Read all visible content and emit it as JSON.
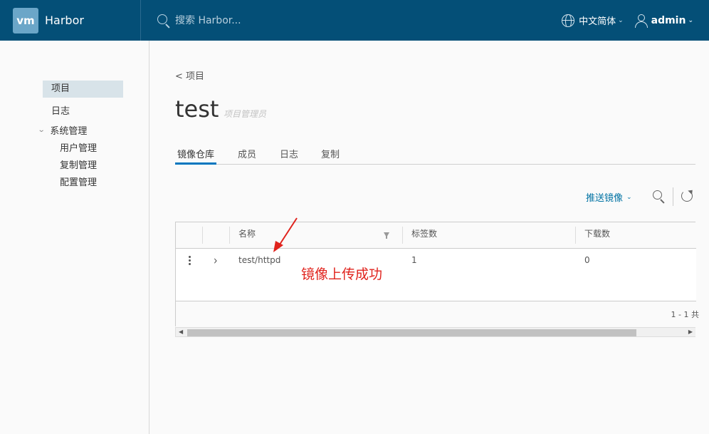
{
  "header": {
    "logo_text": "vm",
    "app_name": "Harbor",
    "search_placeholder": "搜索 Harbor...",
    "language": "中文简体",
    "user": "admin"
  },
  "sidebar": {
    "items": [
      {
        "label": "项目",
        "active": true
      },
      {
        "label": "日志"
      },
      {
        "label": "系统管理",
        "expanded": true
      }
    ],
    "admin_sub": [
      "用户管理",
      "复制管理",
      "配置管理"
    ]
  },
  "main": {
    "back_label": "< 项目",
    "title": "test",
    "role": "项目管理员",
    "tabs": [
      {
        "label": "镜像仓库",
        "active": true
      },
      {
        "label": "成员"
      },
      {
        "label": "日志"
      },
      {
        "label": "复制"
      }
    ],
    "push_image_label": "推送镜像",
    "table": {
      "columns": [
        "名称",
        "标签数",
        "下载数"
      ],
      "rows": [
        {
          "name": "test/httpd",
          "tags": "1",
          "pulls": "0"
        }
      ],
      "pagination": "1 - 1 共"
    },
    "annotation": "镜像上传成功"
  },
  "colors": {
    "header_bg": "#044f77",
    "accent": "#0076bf",
    "link": "#0072a3",
    "annotation": "#e0231d"
  }
}
